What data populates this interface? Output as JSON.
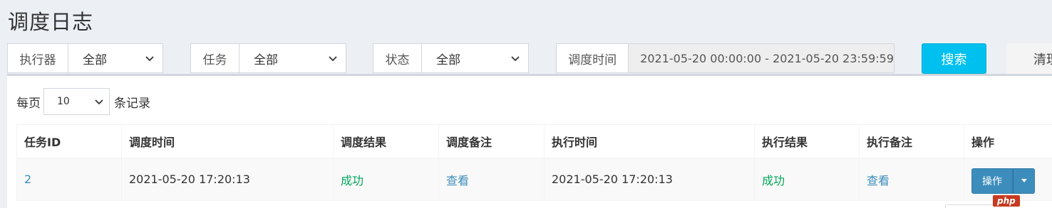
{
  "page": {
    "title": "调度日志"
  },
  "filters": {
    "executor": {
      "label": "执行器",
      "value": "全部"
    },
    "job": {
      "label": "任务",
      "value": "全部"
    },
    "status": {
      "label": "状态",
      "value": "全部"
    },
    "trigger_time": {
      "label": "调度时间",
      "value": "2021-05-20 00:00:00 - 2021-05-20 23:59:59"
    }
  },
  "actions": {
    "search_label": "搜索",
    "clear_label": "清理"
  },
  "pagination": {
    "prefix": "每页",
    "size": "10",
    "suffix": "条记录"
  },
  "table": {
    "columns": [
      "任务ID",
      "调度时间",
      "调度结果",
      "调度备注",
      "执行时间",
      "执行结果",
      "执行备注",
      "操作"
    ],
    "rows": [
      {
        "job_id": "2",
        "trigger_time": "2021-05-20 17:20:13",
        "trigger_result": "成功",
        "trigger_note": "查看",
        "handle_time": "2021-05-20 17:20:13",
        "handle_result": "成功",
        "handle_note": "查看",
        "operate_label": "操作"
      }
    ]
  },
  "watermark": {
    "text": "php"
  },
  "colors": {
    "accent": "#00c0ef",
    "primary": "#3c8dbc",
    "success": "#00a65a",
    "background": "#ecf0f5"
  }
}
